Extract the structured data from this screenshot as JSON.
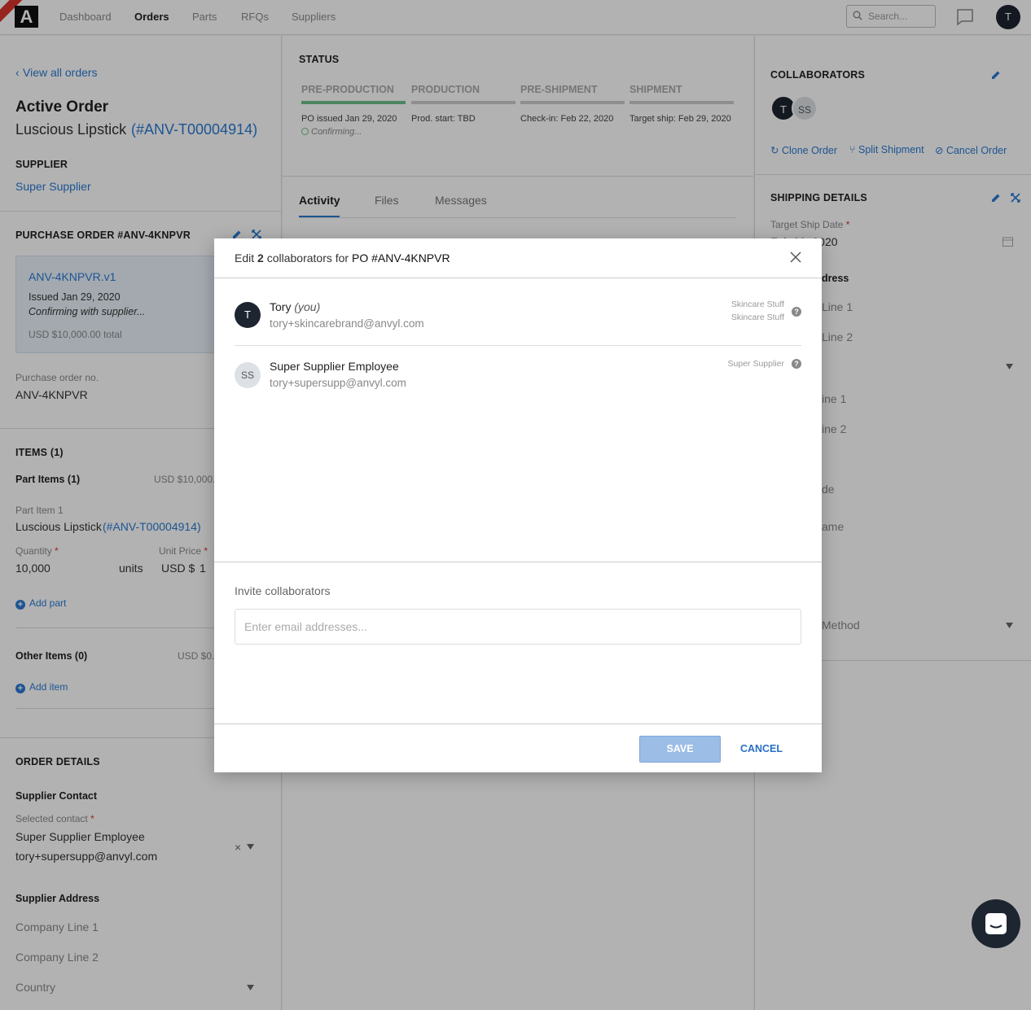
{
  "topbar": {
    "logo": "A",
    "nav": [
      "Dashboard",
      "Orders",
      "Parts",
      "RFQs",
      "Suppliers"
    ],
    "active_nav": "Orders",
    "search_placeholder": "Search...",
    "user_initial": "T"
  },
  "left": {
    "back_link": "View all orders",
    "heading": "Active Order",
    "order_name": "Luscious Lipstick",
    "order_id": "(#ANV-T00004914)",
    "supplier_label": "SUPPLIER",
    "supplier_name": "Super Supplier",
    "po_heading": "PURCHASE ORDER #ANV-4KNPVR",
    "po_card": {
      "version": "ANV-4KNPVR.v1",
      "issued": "Issued Jan 29, 2020",
      "status": "Confirming with supplier...",
      "total": "USD $10,000.00 total"
    },
    "po_no_label": "Purchase order no.",
    "po_no_value": "ANV-4KNPVR",
    "items_heading": "ITEMS (1)",
    "part_items_label": "Part Items (1)",
    "part_items_total": "USD $10,000.",
    "part_item_label": "Part Item 1",
    "part_item_name": "Luscious Lipstick",
    "part_item_id": "(#ANV-T00004914)",
    "quantity_label": "Quantity",
    "quantity_value": "10,000",
    "units": "units",
    "unit_price_label": "Unit Price",
    "unit_price_prefix": "USD $",
    "unit_price_value": "1",
    "add_part": "Add part",
    "other_items_label": "Other Items (0)",
    "other_items_total": "USD $0.",
    "add_item": "Add item",
    "order_details_heading": "ORDER DETAILS",
    "supplier_contact_label": "Supplier Contact",
    "selected_contact_label": "Selected contact",
    "contact_name": "Super Supplier Employee",
    "contact_email": "tory+supersupp@anvyl.com",
    "clear_symbol": "×",
    "supplier_address_label": "Supplier Address",
    "company_line1": "Company Line 1",
    "company_line2": "Company Line 2",
    "country": "Country"
  },
  "middle": {
    "status_heading": "STATUS",
    "stages": [
      {
        "name": "PRE-PRODUCTION",
        "note": "PO issued Jan 29, 2020",
        "sub": "Confirming..."
      },
      {
        "name": "PRODUCTION",
        "note": "Prod. start: TBD",
        "sub": ""
      },
      {
        "name": "PRE-SHIPMENT",
        "note": "Check-in: Feb 22, 2020",
        "sub": ""
      },
      {
        "name": "SHIPMENT",
        "note": "Target ship: Feb 29, 2020",
        "sub": ""
      }
    ],
    "tabs": [
      "Activity",
      "Files",
      "Messages"
    ],
    "active_tab": "Activity"
  },
  "right": {
    "collaborators_heading": "COLLABORATORS",
    "avatars": [
      "T",
      "SS"
    ],
    "actions": [
      "Clone Order",
      "Split Shipment",
      "Cancel Order"
    ],
    "shipping_heading": "SHIPPING DETAILS",
    "target_ship_label": "Target Ship Date",
    "target_ship_value": "Feb 29, 2020",
    "address_partial": "dress",
    "line1_partial": "Line 1",
    "line2_partial": "Line 2",
    "ine1_partial": "ine 1",
    "ine2_partial": "ine 2",
    "de_partial": "de",
    "ame_partial": "ame",
    "method_partial": "Method"
  },
  "modal": {
    "title_prefix": "Edit",
    "count": "2",
    "title_mid": "collaborators for",
    "po": "PO #ANV-4KNPVR",
    "collaborators": [
      {
        "initials": "T",
        "name": "Tory",
        "you": "(you)",
        "email": "tory+skincarebrand@anvyl.com",
        "org1": "Skincare Stuff",
        "org2": "Skincare Stuff"
      },
      {
        "initials": "SS",
        "name": "Super Supplier Employee",
        "you": "",
        "email": "tory+supersupp@anvyl.com",
        "org1": "Super Supplier",
        "org2": ""
      }
    ],
    "invite_label": "Invite collaborators",
    "invite_placeholder": "Enter email addresses...",
    "save": "SAVE",
    "cancel": "CANCEL"
  },
  "colors": {
    "accent": "#2a7ad3",
    "progress_done": "#6cc08b",
    "dark": "#1d2530",
    "required": "#d9342b"
  }
}
